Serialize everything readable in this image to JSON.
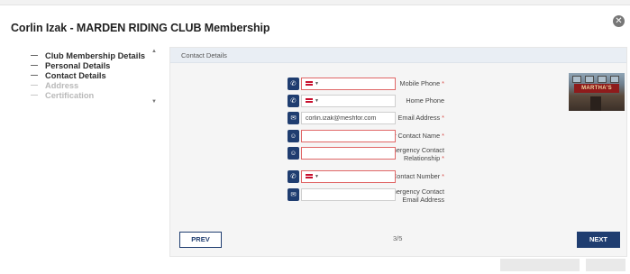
{
  "modal": {
    "title": "Corlin Izak - MARDEN RIDING CLUB Membership",
    "close_icon": "close-icon"
  },
  "steps": [
    {
      "label": "Club Membership Details",
      "state": "done"
    },
    {
      "label": "Personal Details",
      "state": "done"
    },
    {
      "label": "Contact Details",
      "state": "current"
    },
    {
      "label": "Address",
      "state": "future"
    },
    {
      "label": "Certification",
      "state": "future"
    }
  ],
  "panel": {
    "header": "Contact Details",
    "fields": [
      {
        "label": "Mobile Phone",
        "required": true,
        "icon": "phone-icon",
        "type": "phone",
        "value": "",
        "invalid": true
      },
      {
        "label": "Home Phone",
        "required": false,
        "icon": "phone-icon",
        "type": "phone",
        "value": "",
        "invalid": false
      },
      {
        "label": "Email Address",
        "required": true,
        "icon": "envelope-icon",
        "type": "text",
        "value": "corlin.izak@meshfor.com",
        "invalid": false
      },
      {
        "label": "Emergency Contact Name",
        "required": true,
        "icon": "person-circle-icon",
        "type": "text",
        "value": "",
        "invalid": true
      },
      {
        "label": "Emergency Contact Relationship",
        "required": true,
        "icon": "person-circle-icon",
        "type": "text",
        "value": "",
        "invalid": true
      },
      {
        "label": "Emergency Contact Number",
        "required": true,
        "icon": "phone-icon",
        "type": "phone",
        "value": "",
        "invalid": true
      },
      {
        "label": "Emergency Contact Email Address",
        "required": false,
        "icon": "envelope-icon",
        "type": "text",
        "value": "",
        "invalid": false
      }
    ],
    "photo_sign": "MARTHA'S"
  },
  "nav": {
    "prev": "PREV",
    "next": "NEXT",
    "page_count": "3/5"
  },
  "colors": {
    "primary": "#1f3d70",
    "invalid_border": "#e06767",
    "required_mark": "#d9534f",
    "panel_header_bg": "#e9eef4"
  }
}
